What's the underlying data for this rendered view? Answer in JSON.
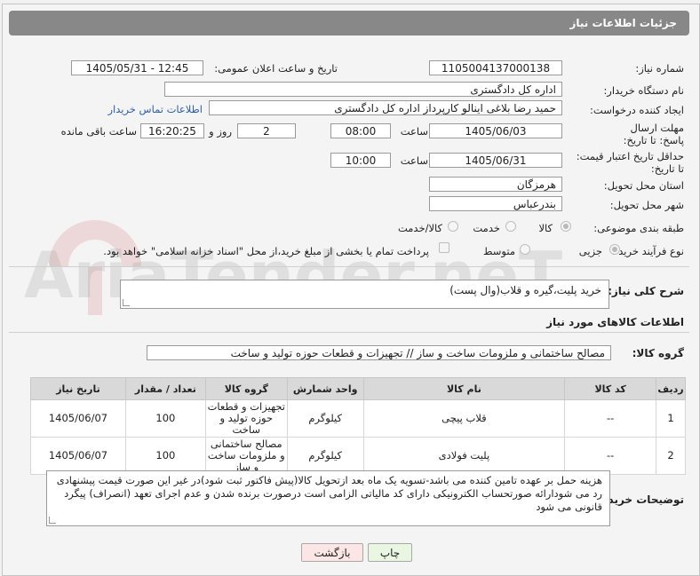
{
  "header": {
    "title": "جزئیات اطلاعات نیاز"
  },
  "need_number": {
    "label": "شماره نیاز:",
    "value": "1105004137000138"
  },
  "announce": {
    "label": "تاریخ و ساعت اعلان عمومی:",
    "value": "1405/05/31 - 12:45"
  },
  "buyer_org": {
    "label": "نام دستگاه خریدار:",
    "value": "اداره کل دادگستری"
  },
  "creator": {
    "label": "ایجاد کننده درخواست:",
    "value": "حمید رضا  بلاغی اینالو کارپرداز اداره کل دادگستری",
    "contact_link": "اطلاعات تماس خریدار"
  },
  "reply_deadline": {
    "label": "مهلت ارسال پاسخ: تا تاریخ:",
    "date": "1405/06/03",
    "time_label": "ساعت",
    "time": "08:00",
    "days": "2",
    "days_label": "روز و",
    "remaining_time": "16:20:25",
    "remaining_label": "ساعت باقی مانده"
  },
  "price_validity": {
    "label": "حداقل تاریخ اعتبار قیمت: تا تاریخ:",
    "date": "1405/06/31",
    "time_label": "ساعت",
    "time": "10:00"
  },
  "province": {
    "label": "استان محل تحویل:",
    "value": "هرمزگان"
  },
  "city": {
    "label": "شهر محل تحویل:",
    "value": "بندرعباس"
  },
  "category": {
    "label": "طبقه بندی موضوعی:",
    "options": [
      "کالا",
      "خدمت",
      "کالا/خدمت"
    ],
    "selected": "کالا"
  },
  "process": {
    "label": "نوع فرآیند خرید :",
    "options": [
      "جزیی",
      "متوسط"
    ],
    "selected": "جزیی",
    "payment_note": "پرداخت تمام یا بخشی از مبلغ خرید،از محل \"اسناد خزانه اسلامی\" خواهد بود."
  },
  "description": {
    "label": "شرح کلی نیاز:",
    "value": "خرید پلیت،گیره و قلاب(وال پست)"
  },
  "items_section": {
    "title": "اطلاعات کالاهای مورد نیاز"
  },
  "goods_group": {
    "label": "گروه کالا:",
    "value": "مصالح ساختمانی و ملزومات ساخت و ساز // تجهیزات و قطعات حوزه تولید و ساخت"
  },
  "table": {
    "headers": [
      "ردیف",
      "کد کالا",
      "نام کالا",
      "واحد شمارش",
      "گروه کالا",
      "تعداد / مقدار",
      "تاریخ نیاز"
    ],
    "rows": [
      [
        "1",
        "--",
        "قلاب پیچی",
        "کیلوگرم",
        "تجهیزات و قطعات حوزه تولید و ساخت",
        "100",
        "1405/06/07"
      ],
      [
        "2",
        "--",
        "پلیت فولادی",
        "کیلوگرم",
        "مصالح ساختمانی و ملزومات ساخت و ساز",
        "100",
        "1405/06/07"
      ]
    ]
  },
  "buyer_notes": {
    "label": "توضیحات خریدار:",
    "value": "هزینه حمل بر عهده تامین کننده می باشد-تسویه یک ماه بعد ازتحویل کالا(پیش فاکتور ثبت شود)در غیر این صورت قیمت پیشنهادی رد می شودارائه صورتحساب الکترونیکی دارای کد مالیاتی الزامی است درصورت برنده شدن و عدم اجرای تعهد (انصراف) پیگرد قانونی می شود"
  },
  "buttons": {
    "print": "چاپ",
    "back": "بازگشت"
  },
  "watermark": {
    "text": "AriaTender.neT"
  },
  "colors": {
    "header_bg": "#888888",
    "link": "#2a5fb0",
    "print_btn": "#e9f7e2",
    "back_btn": "#fbe5e5"
  }
}
